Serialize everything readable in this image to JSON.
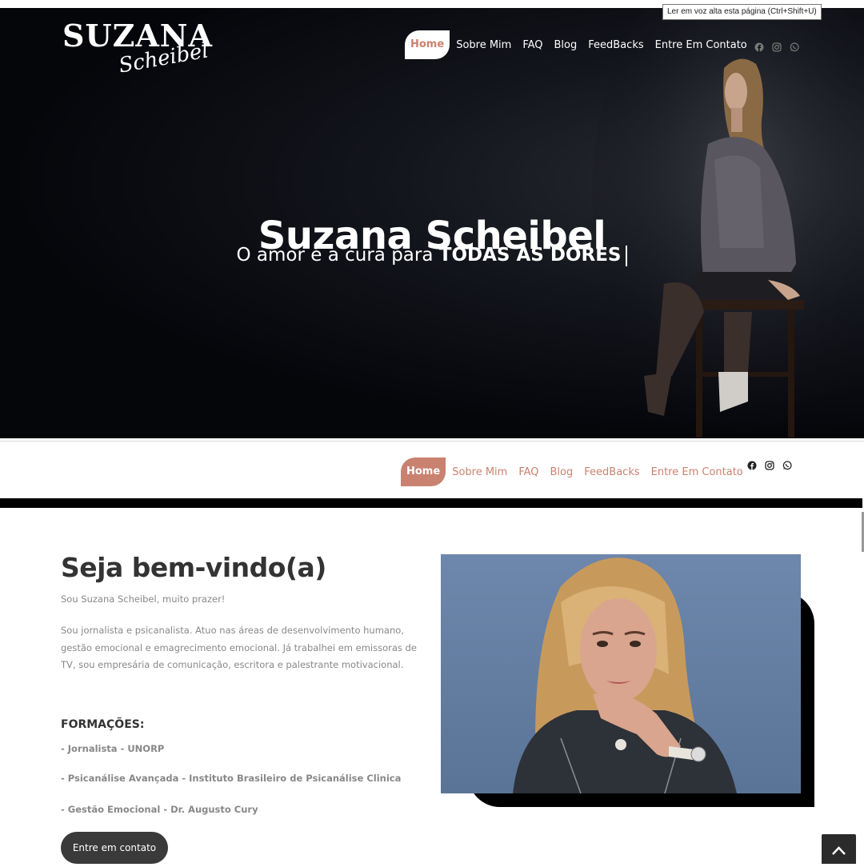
{
  "tooltip": "Ler em voz alta esta página (Ctrl+Shift+U)",
  "logo": {
    "main": "SUZANA",
    "script": "Scheibel"
  },
  "nav": [
    "Home",
    "Sobre Mim",
    "FAQ",
    "Blog",
    "FeedBacks",
    "Entre Em Contato"
  ],
  "social_icons": [
    "facebook-icon",
    "instagram-icon",
    "whatsapp-icon"
  ],
  "hero": {
    "title": "Suzana Scheibel",
    "subtitle_prefix": "O amor é a cura para",
    "subtitle_bold": "TODAS AS DORES"
  },
  "welcome": {
    "title": "Seja bem-vindo(a)",
    "intro": "Sou Suzana Scheibel, muito prazer!",
    "paragraph": "Sou jornalista e psicanalista. Atuo nas áreas de desenvolvimento humano, gestão emocional e emagrecimento emocional. Já trabalhei em emissoras de TV, sou empresária de comunicação, escritora e palestrante motivacional.",
    "formacoes_title": "FORMAÇÕES:",
    "formacoes": [
      "- Jornalista - UNORP",
      "- Psicanálise Avançada - Instituto Brasileiro de Psicanálise Clinica",
      "- Gestão Emocional - Dr. Augusto Cury"
    ],
    "cta": "Entre em contato"
  },
  "colors": {
    "accent": "#c9826f",
    "dark": "#3a3a3a",
    "text_gray": "#888888"
  }
}
